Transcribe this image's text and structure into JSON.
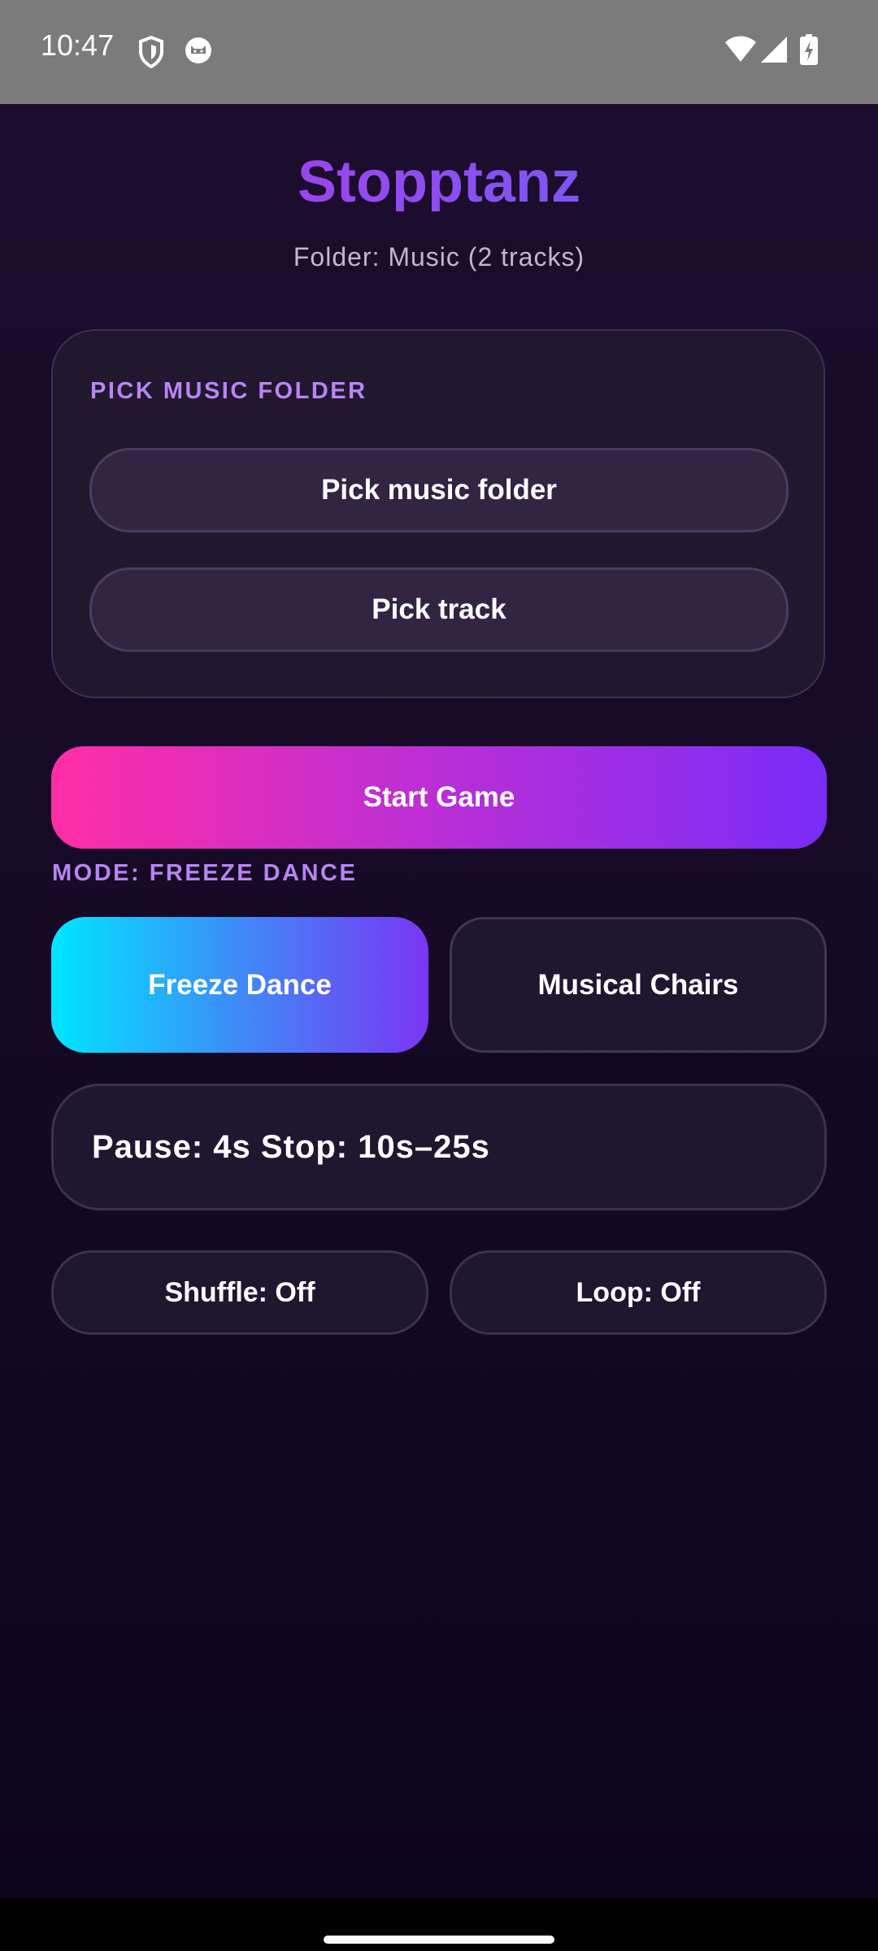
{
  "status_bar": {
    "time": "10:47",
    "left_icons": [
      "shield-icon",
      "cat-icon"
    ],
    "right_icons": [
      "wifi-icon",
      "cell-signal-icon",
      "battery-charging-icon"
    ]
  },
  "header": {
    "title": "Stopptanz",
    "subtitle": "Folder: Music (2 tracks)"
  },
  "music_card": {
    "section_label": "PICK MUSIC FOLDER",
    "pick_folder_label": "Pick music folder",
    "pick_track_label": "Pick track"
  },
  "start_button_label": "Start Game",
  "mode": {
    "label": "MODE: FREEZE DANCE",
    "options": [
      {
        "label": "Freeze Dance",
        "selected": true
      },
      {
        "label": "Musical Chairs",
        "selected": false
      }
    ]
  },
  "timing_text": "Pause: 4s Stop: 10s–25s",
  "toggles": {
    "shuffle_label": "Shuffle: Off",
    "loop_label": "Loop: Off"
  },
  "colors": {
    "background": "#150924",
    "accent_purple": "#a048ee",
    "start_gradient_from": "#ff2ea6",
    "start_gradient_to": "#7a2cf7",
    "selected_gradient_from": "#00e6ff",
    "selected_gradient_to": "#7a36f2",
    "section_label": "#b785f3"
  }
}
